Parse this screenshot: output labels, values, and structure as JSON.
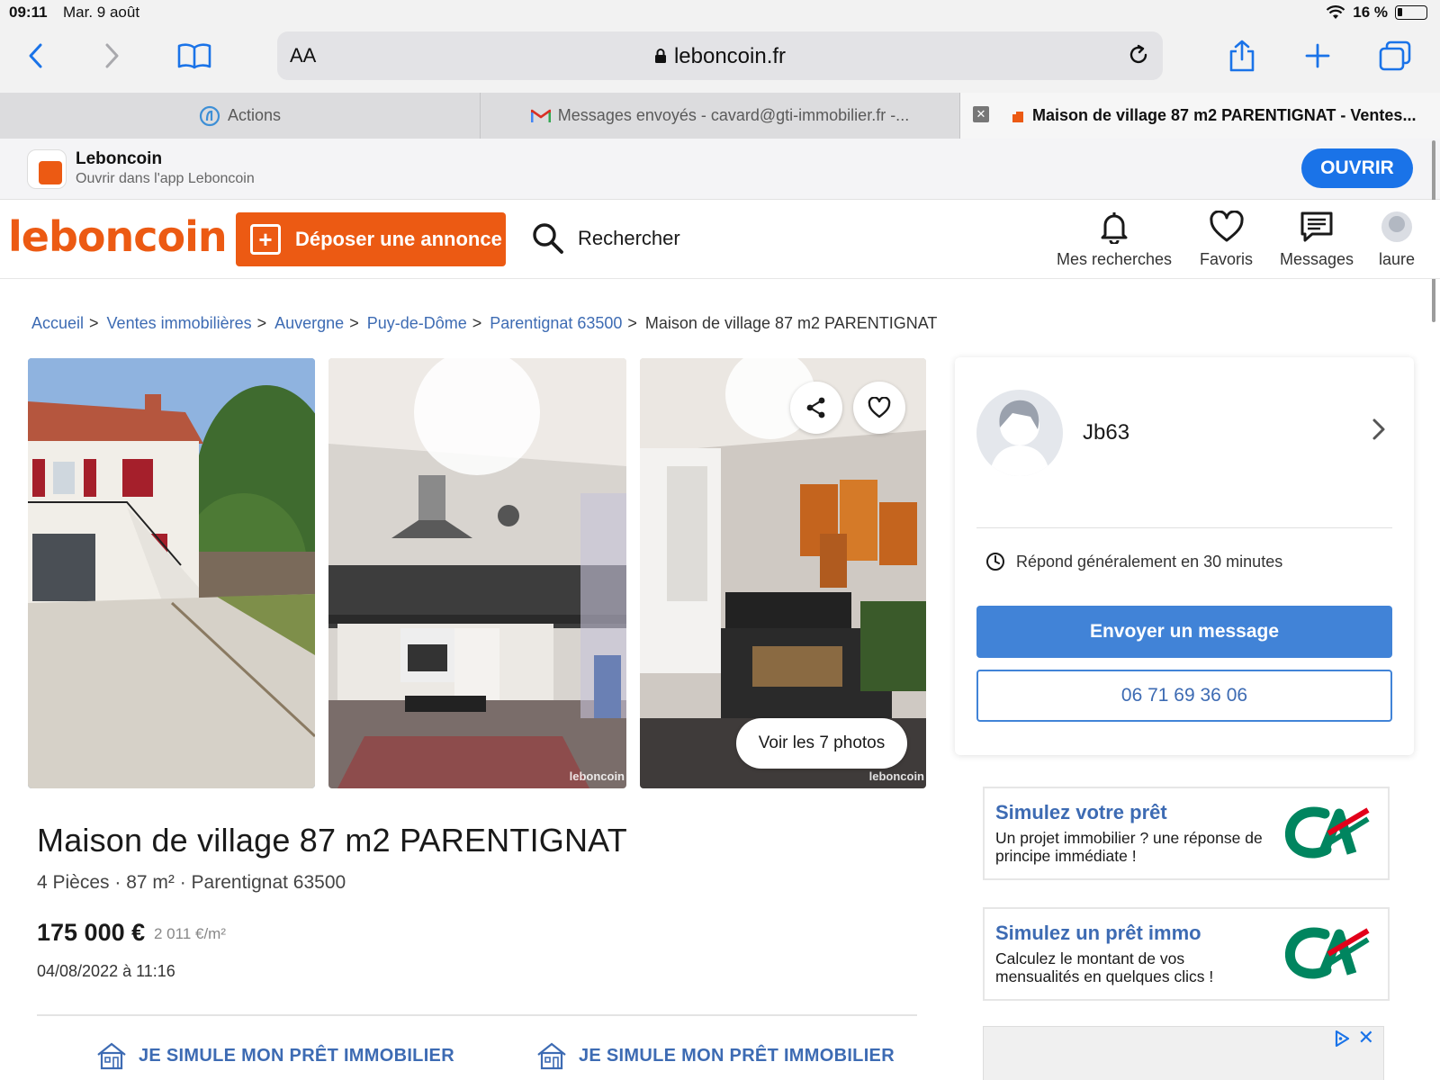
{
  "status": {
    "time": "09:11",
    "date": "Mar. 9 août",
    "battery": "16 %",
    "battery_level": 0.16
  },
  "toolbar": {
    "aa_label": "AA",
    "url": "leboncoin.fr"
  },
  "tabs": [
    {
      "label": "Actions"
    },
    {
      "label": "Messages envoyés - cavard@gti-immobilier.fr -..."
    },
    {
      "label": "Maison de village 87 m2 PARENTIGNAT - Ventes..."
    }
  ],
  "app_banner": {
    "name": "Leboncoin",
    "subtitle": "Ouvrir dans l'app Leboncoin",
    "open_label": "OUVRIR"
  },
  "header": {
    "logo": "leboncoin",
    "post_label": "Déposer une annonce",
    "search_label": "Rechercher",
    "nav": [
      {
        "label": "Mes recherches",
        "icon": "bell-icon"
      },
      {
        "label": "Favoris",
        "icon": "heart-icon"
      },
      {
        "label": "Messages",
        "icon": "message-icon"
      },
      {
        "label": "laure",
        "icon": "avatar"
      }
    ]
  },
  "breadcrumb": {
    "links": [
      "Accueil",
      "Ventes immobilières",
      "Auvergne",
      "Puy-de-Dôme",
      "Parentignat 63500"
    ],
    "current": "Maison de village 87 m2 PARENTIGNAT",
    "separator": ">"
  },
  "gallery": {
    "watermark": "leboncoin",
    "see_photos_label": "Voir les 7 photos"
  },
  "listing": {
    "title": "Maison de village 87 m2 PARENTIGNAT",
    "details": "4 Pièces · 87 m² · Parentignat 63500",
    "price": "175 000 €",
    "price_per_m2": "2 011 €/m²",
    "date": "04/08/2022 à 11:16"
  },
  "simulate_links": [
    "JE SIMULE MON PRÊT IMMOBILIER",
    "JE SIMULE MON PRÊT IMMOBILIER"
  ],
  "seller": {
    "name": "Jb63",
    "response": "Répond généralement en 30 minutes",
    "message_label": "Envoyer un message",
    "phone": "06 71 69 36 06"
  },
  "ads": [
    {
      "title": "Simulez votre prêt",
      "body": "Un projet immobilier ? une réponse de principe immédiate !"
    },
    {
      "title": "Simulez un prêt immo",
      "body": "Calculez le montant de vos mensualités en quelques clics !"
    }
  ],
  "colors": {
    "brand_orange": "#ec5a13",
    "link_blue": "#3d6bb3",
    "button_blue": "#4183d7",
    "ios_blue": "#1a73e8",
    "ca_green": "#00855f",
    "ca_red": "#e2001a"
  }
}
